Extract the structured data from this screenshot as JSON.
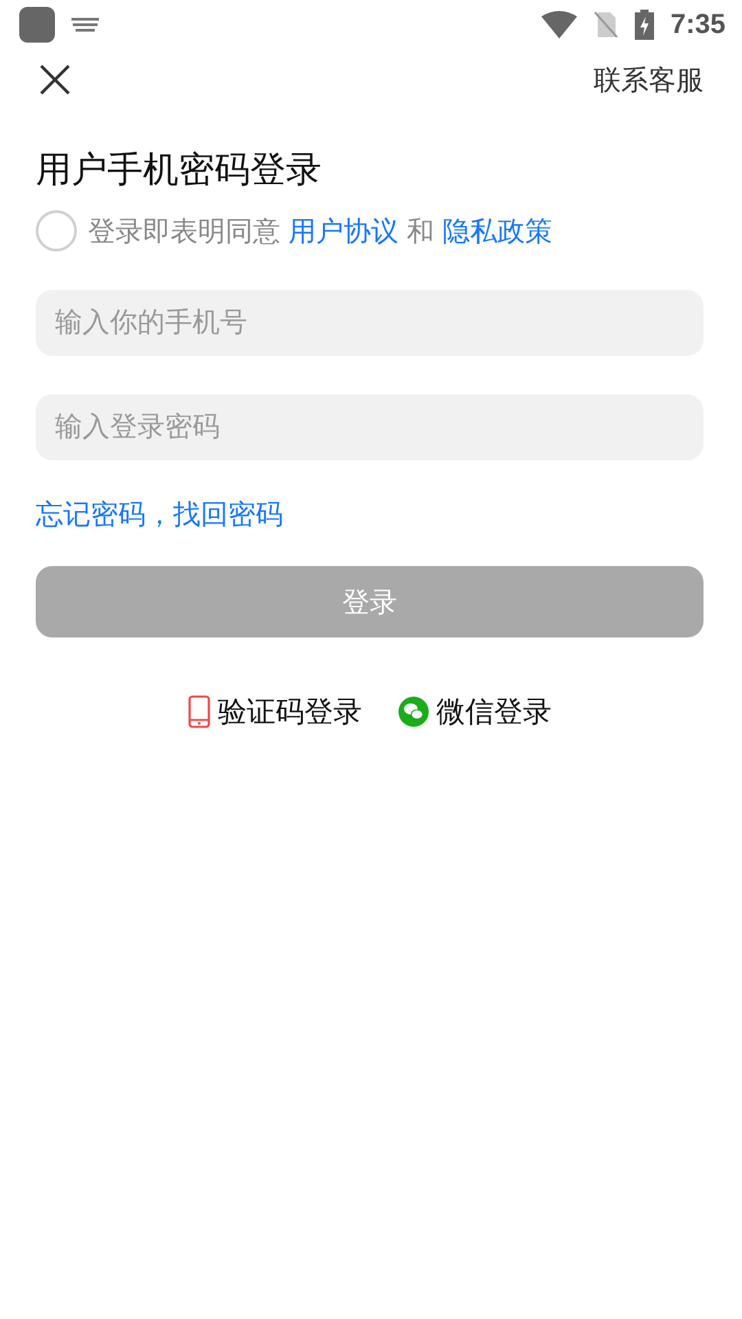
{
  "status_bar": {
    "time": "7:35"
  },
  "header": {
    "contact": "联系客服"
  },
  "title": "用户手机密码登录",
  "agreement": {
    "checked": false,
    "parts": [
      {
        "kind": "text",
        "text": "登录即表明同意"
      },
      {
        "kind": "link",
        "text": "用户协议"
      },
      {
        "kind": "text",
        "text": "和"
      },
      {
        "kind": "link",
        "text": "隐私政策"
      }
    ]
  },
  "fields": [
    {
      "placeholder": "输入你的手机号"
    },
    {
      "placeholder": "输入登录密码"
    }
  ],
  "forgot": "忘记密码，找回密码",
  "login_button": {
    "label": "登录",
    "disabled": true
  },
  "alt_logins": [
    {
      "kind": "sms",
      "label": "验证码登录"
    },
    {
      "kind": "wechat",
      "label": "微信登录"
    }
  ]
}
